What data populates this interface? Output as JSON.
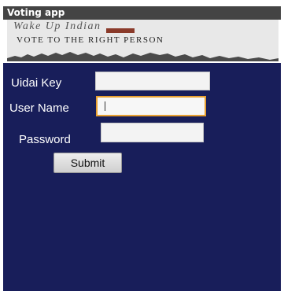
{
  "app": {
    "title": "Voting app"
  },
  "banner": {
    "line1": "Wake Up Indian",
    "line2": "VOTE TO THE RIGHT PERSON"
  },
  "form": {
    "uidai_label": "Uidai Key",
    "uidai_value": "",
    "username_label": "User Name",
    "username_value": "",
    "password_label": "Password",
    "password_value": "",
    "submit_label": "Submit"
  },
  "colors": {
    "titlebar": "#444444",
    "panel": "#181e5a",
    "focus_border": "#e8a030"
  }
}
